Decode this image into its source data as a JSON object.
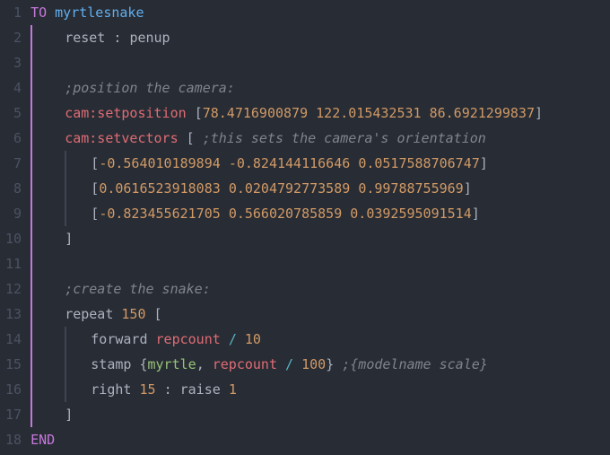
{
  "code": {
    "line_count": 18,
    "keywords": {
      "to": "TO",
      "end": "END",
      "repeat": "repeat"
    },
    "procedure_name": "myrtlesnake",
    "reset": "reset",
    "colon": ":",
    "penup": "penup",
    "comment_position": ";position the camera:",
    "cam_setposition": "cam:setposition",
    "cam_setposition_vals": [
      "78.4716900879",
      "122.015432531",
      "86.6921299837"
    ],
    "cam_setvectors": "cam:setvectors",
    "comment_setvectors": ";this sets the camera's orientation",
    "vec1": [
      "-0.564010189894",
      "-0.824144116646",
      "0.0517588706747"
    ],
    "vec2": [
      "0.0616523918083",
      "0.0204792773589",
      "0.99788755969"
    ],
    "vec3": [
      "-0.823455621705",
      "0.566020785859",
      "0.0392595091514"
    ],
    "comment_create": ";create the snake:",
    "one_fifty": "150",
    "forward": "forward",
    "repcount": "repcount",
    "slash": "/",
    "ten": "10",
    "stamp": "stamp",
    "myrtle": "myrtle",
    "comma": ",",
    "hundred": "100",
    "comment_model": ";{modelname scale}",
    "right": "right",
    "fifteen": "15",
    "raise": "raise",
    "one": "1",
    "lbracket": "[",
    "rbracket": "]",
    "lbrace": "{",
    "rbrace": "}"
  }
}
